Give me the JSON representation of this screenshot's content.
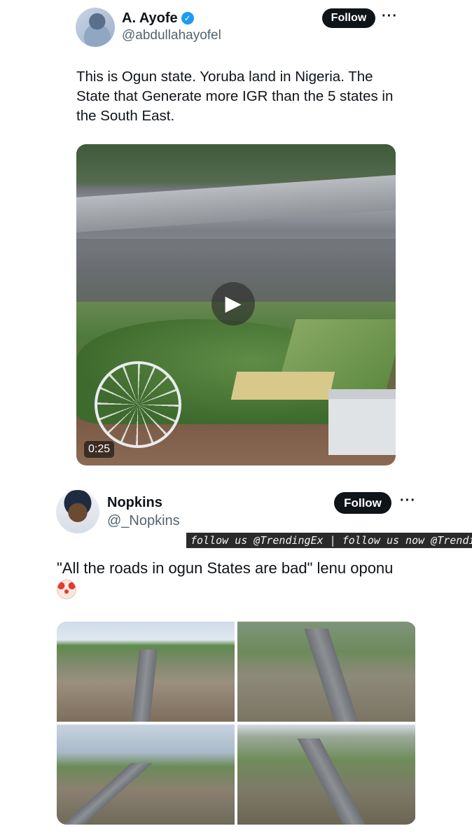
{
  "post1": {
    "author_name": "A. Ayofe",
    "handle": "@abdullahayofel",
    "follow_label": "Follow",
    "more_label": "···",
    "text": "This is Ogun state. Yoruba land in Nigeria. The State that Generate more IGR than the 5 states in the South East.",
    "video": {
      "duration": "0:25",
      "play_symbol": "▶"
    }
  },
  "post2": {
    "author_name": "Nopkins",
    "handle": "@_Nopkins",
    "follow_label": "Follow",
    "more_label": "···",
    "text": "\"All the roads in ogun States are bad\" lenu oponu",
    "emoji": "clown-face"
  },
  "watermark": {
    "text": "follow us @TrendingEx | follow us now @TrendingEx"
  },
  "colors": {
    "primary_text": "#0f1419",
    "secondary_text": "#536471",
    "button_bg": "#0f1419",
    "verified": "#1d9bf0"
  }
}
